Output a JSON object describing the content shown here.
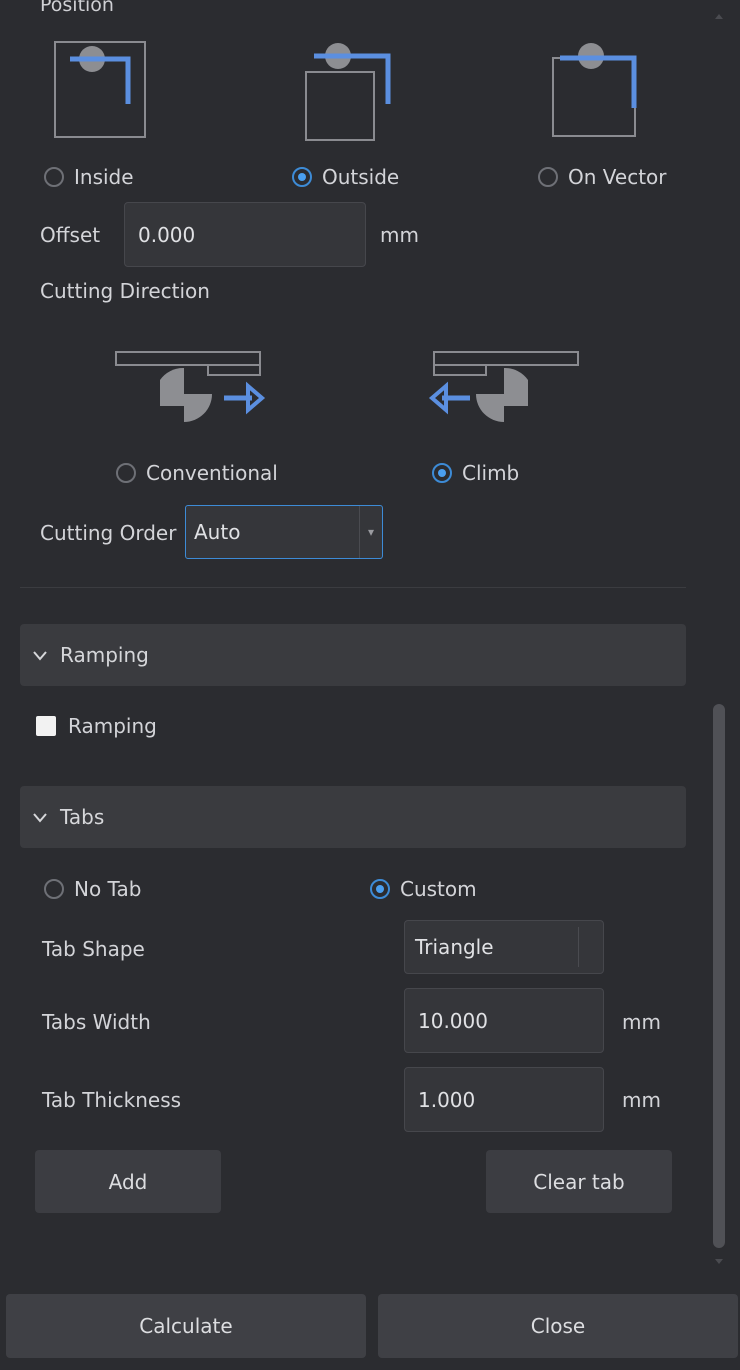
{
  "position": {
    "title": "Position",
    "options": [
      {
        "label": "Inside",
        "checked": false
      },
      {
        "label": "Outside",
        "checked": true
      },
      {
        "label": "On Vector",
        "checked": false
      }
    ],
    "offset_label": "Offset",
    "offset_value": "0.000",
    "offset_unit": "mm"
  },
  "cutting_direction": {
    "title": "Cutting Direction",
    "options": [
      {
        "label": "Conventional",
        "checked": false
      },
      {
        "label": "Climb",
        "checked": true
      }
    ]
  },
  "cutting_order": {
    "label": "Cutting Order",
    "value": "Auto"
  },
  "ramping": {
    "header": "Ramping",
    "checkbox_label": "Ramping",
    "checked": false
  },
  "tabs": {
    "header": "Tabs",
    "options": [
      {
        "label": "No Tab",
        "checked": false
      },
      {
        "label": "Custom",
        "checked": true
      }
    ],
    "shape_label": "Tab Shape",
    "shape_value": "Triangle",
    "width_label": "Tabs Width",
    "width_value": "10.000",
    "width_unit": "mm",
    "thickness_label": "Tab Thickness",
    "thickness_value": "1.000",
    "thickness_unit": "mm",
    "add_label": "Add",
    "clear_label": "Clear tab"
  },
  "footer": {
    "calculate_label": "Calculate",
    "close_label": "Close"
  },
  "colors": {
    "background": "#2b2c30",
    "accent": "#4a9ff0",
    "panel": "#3a3b3f",
    "diagram_line": "#5b8fe0"
  }
}
